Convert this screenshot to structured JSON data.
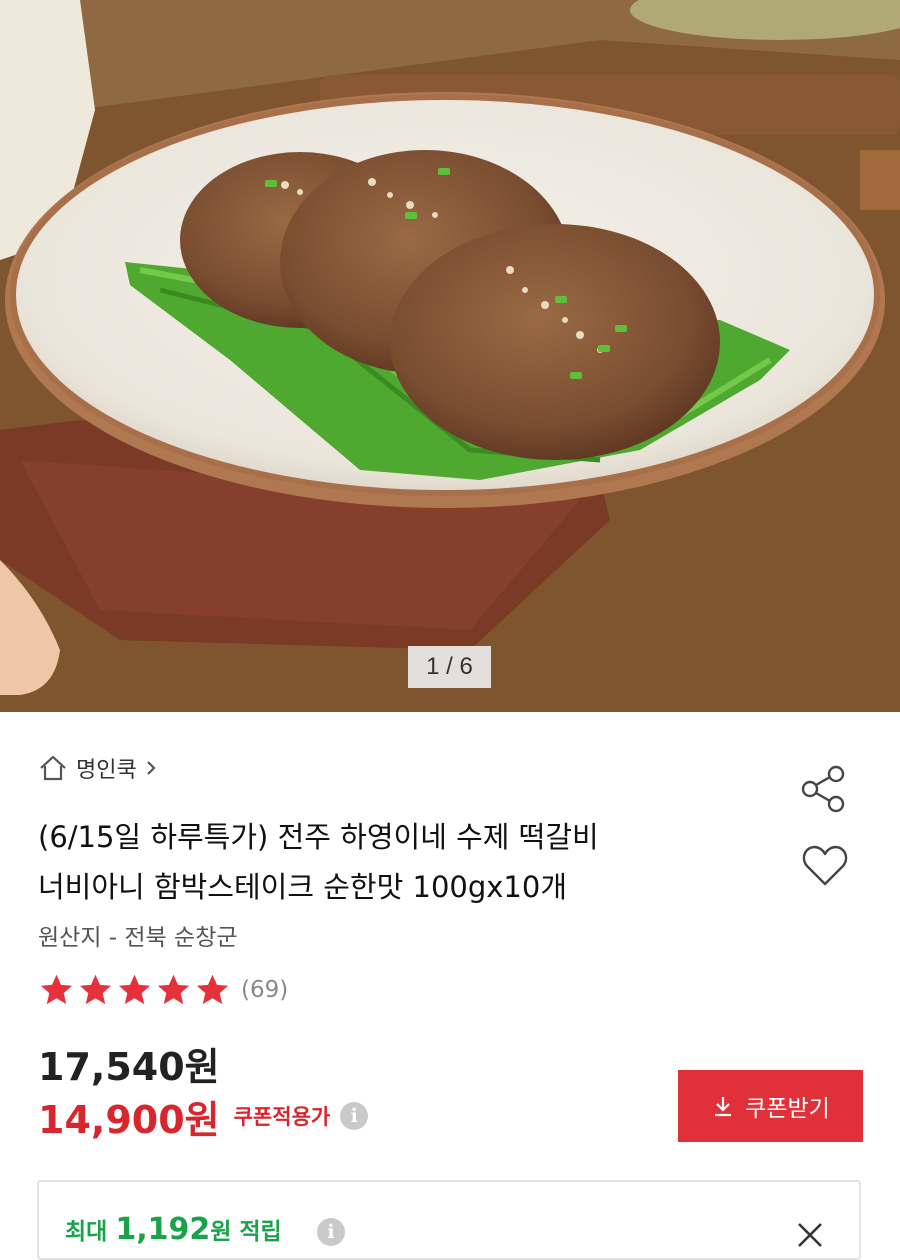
{
  "gallery": {
    "counter": "1 / 6",
    "alt": "떡갈비 product photo"
  },
  "store": {
    "name": "명인쿡",
    "icon": "home-icon",
    "chevron": "chevron-right-icon"
  },
  "actions": {
    "share_icon": "share-icon",
    "wishlist_icon": "heart-icon"
  },
  "product": {
    "title_line1": "(6/15일 하루특가) 전주 하영이네 수제 떡갈비",
    "title_line2": "너비아니 함박스테이크 순한맛 100gx10개",
    "origin": "원산지 - 전북 순창군",
    "rating_stars": 5,
    "rating_count": "(69)",
    "star_color": "#e4313b"
  },
  "price": {
    "original": "17,540원",
    "sale": "14,900원",
    "coupon_label": "쿠폰적용가",
    "info_icon": "info-icon",
    "sale_color": "#d7262d"
  },
  "coupon_button": {
    "label": "쿠폰받기",
    "icon": "download-icon",
    "color": "#e0303a"
  },
  "points": {
    "prefix": "최대 ",
    "amount": "1,192",
    "suffix": "원 적립",
    "color": "#18a34a",
    "close_icon": "close-icon"
  }
}
